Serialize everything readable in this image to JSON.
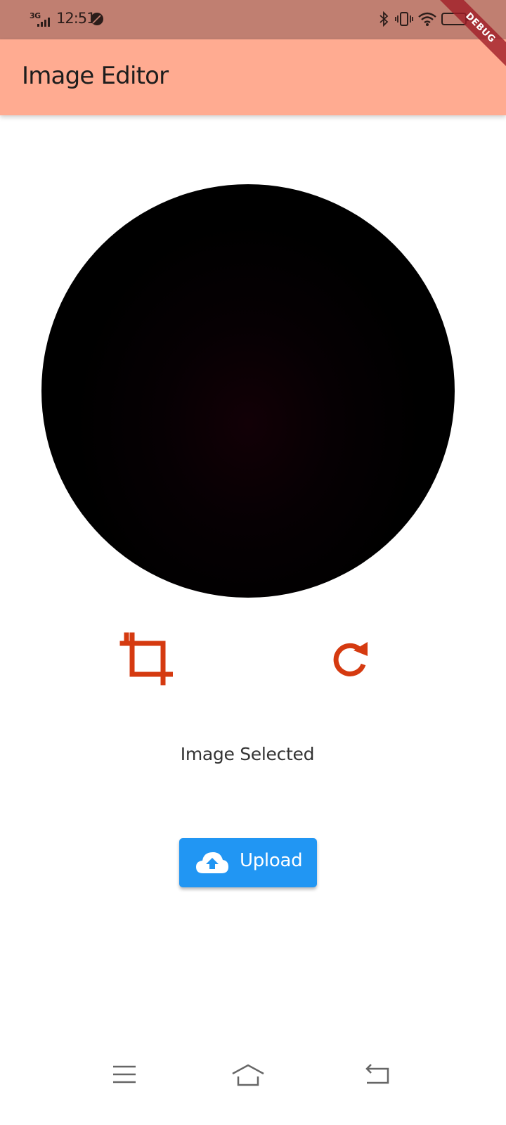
{
  "status_bar": {
    "network": "3G",
    "time": "12:51",
    "background": "#c07f71"
  },
  "debug_banner": "DEBUG",
  "app_bar": {
    "title": "Image Editor",
    "background": "#ffab91"
  },
  "actions": {
    "crop_icon": "crop-icon",
    "rotate_icon": "rotate-icon",
    "icon_color": "#d53a10"
  },
  "status_message": "Image Selected",
  "upload_button": {
    "label": "Upload",
    "icon": "cloud-upload-icon",
    "color": "#2196f3"
  },
  "nav_bar": {
    "items": [
      "menu-icon",
      "home-icon",
      "back-icon"
    ]
  }
}
